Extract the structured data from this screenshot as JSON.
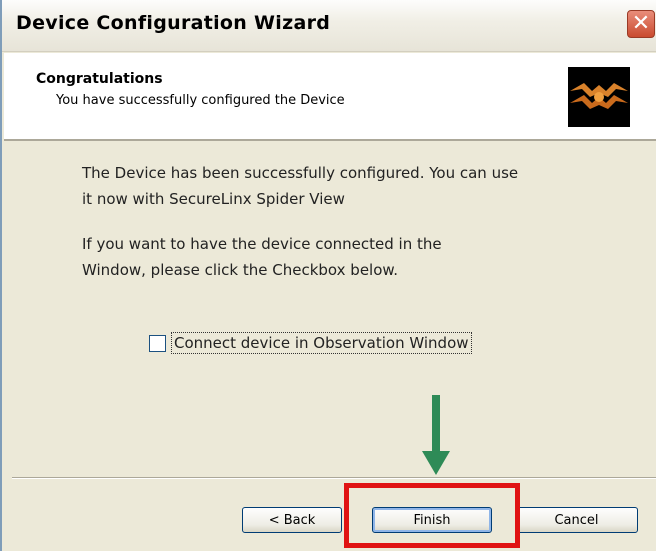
{
  "window": {
    "title": "Device Configuration Wizard",
    "close_icon": "close-icon"
  },
  "header": {
    "title": "Congratulations",
    "subtitle": "You have successfully configured the Device",
    "logo_icon": "spider-logo-icon"
  },
  "body": {
    "paragraph1_line1": "The Device has been successfully configured. You can use",
    "paragraph1_line2": "it now with SecureLinx Spider View",
    "paragraph2_line1": "If you want to have the device connected in the",
    "paragraph2_line2": "Window, please click the Checkbox below."
  },
  "checkbox": {
    "label": "Connect device in Observation Window",
    "checked": false
  },
  "buttons": {
    "back": "< Back",
    "finish": "Finish",
    "cancel": "Cancel"
  },
  "annotations": {
    "arrow_color": "#2e8b57",
    "highlight_color": "#e01313"
  }
}
